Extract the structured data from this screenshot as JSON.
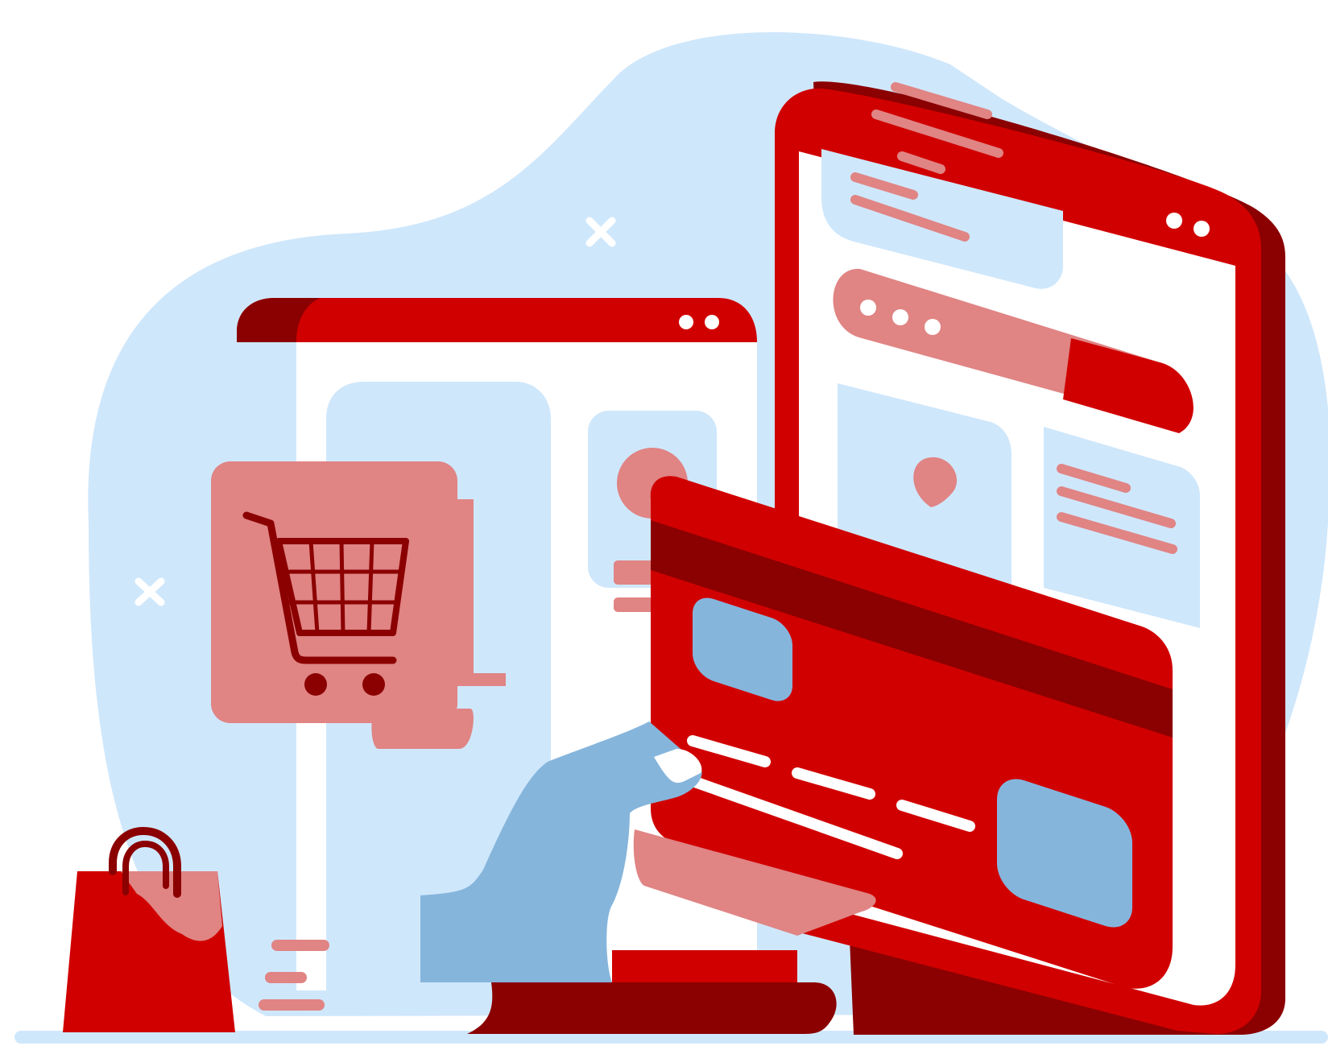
{
  "illustration": {
    "subject": "online-shopping-card-payment",
    "elements": [
      "background-blob",
      "sparkle-icon",
      "browser-window",
      "shopping-cart-icon",
      "phone",
      "location-pin-icon",
      "credit-card",
      "hand",
      "shopping-bag-icon",
      "ground-line"
    ]
  },
  "colors": {
    "background": "#ffffff",
    "blob": "#cfe7fb",
    "red": "#d10000",
    "dark_red": "#8b0000",
    "pink": "#e08484",
    "blue": "#86b5dc",
    "white": "#ffffff"
  },
  "icons": {
    "cart": "shopping-cart-icon",
    "pin": "location-pin-icon",
    "bag": "shopping-bag-icon",
    "sparkle": "sparkle-icon"
  }
}
